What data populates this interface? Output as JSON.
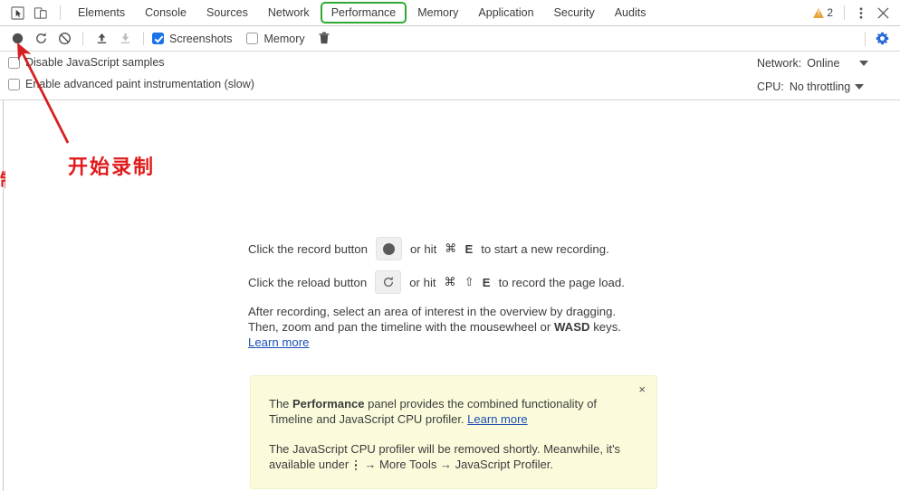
{
  "tabbar": {
    "inspect_icon": "inspect-element-icon",
    "device_icon": "device-toolbar-icon",
    "tabs": [
      {
        "label": "Elements",
        "highlighted": false
      },
      {
        "label": "Console",
        "highlighted": false
      },
      {
        "label": "Sources",
        "highlighted": false
      },
      {
        "label": "Network",
        "highlighted": false
      },
      {
        "label": "Performance",
        "highlighted": true
      },
      {
        "label": "Memory",
        "highlighted": false
      },
      {
        "label": "Application",
        "highlighted": false
      },
      {
        "label": "Security",
        "highlighted": false
      },
      {
        "label": "Audits",
        "highlighted": false
      }
    ],
    "warning_count": "2",
    "warning_icon": "warning-triangle-icon",
    "more_icon": "kebab-menu-icon",
    "close_icon": "close-icon",
    "highlight_color": "#2eaa33"
  },
  "toolbar": {
    "record_icon": "record-circle-icon",
    "reload_icon": "reload-icon",
    "clear_icon": "clear-no-entry-icon",
    "load_profile_icon": "upload-arrow-icon",
    "save_profile_icon": "download-arrow-icon",
    "screenshots_label": "Screenshots",
    "screenshots_checked": true,
    "memory_label": "Memory",
    "memory_checked": false,
    "trash_icon": "trash-icon",
    "settings_icon": "gear-icon",
    "settings_color": "#2a6ad8",
    "checkbox_color": "#1a73e8"
  },
  "settings": {
    "disable_js_label": "Disable JavaScript samples",
    "disable_js_checked": false,
    "paint_instr_label": "Enable advanced paint instrumentation (slow)",
    "paint_instr_checked": false,
    "network_label": "Network:",
    "network_value": "Online",
    "cpu_label": "CPU:",
    "cpu_value": "No throttling"
  },
  "main": {
    "record_line_prefix": "Click the record button",
    "record_line_mid": "or hit",
    "record_key_cmd": "⌘",
    "record_key_letter": "E",
    "record_line_suffix": "to start a new recording.",
    "reload_line_prefix": "Click the reload button",
    "reload_line_mid": "or hit",
    "reload_key_cmd": "⌘",
    "reload_key_shift": "⇧",
    "reload_key_letter": "E",
    "reload_line_suffix": "to record the page load.",
    "paragraph_line1": "After recording, select an area of interest in the overview by dragging.",
    "paragraph_line2_a": "Then, zoom and pan the timeline with the mousewheel or",
    "paragraph_line2_bold": "WASD",
    "paragraph_line2_b": "keys.",
    "learn_more": "Learn more",
    "link_color": "#1a4fb4"
  },
  "notice": {
    "close_label": "×",
    "p1_a": "The ",
    "p1_bold": "Performance",
    "p1_b": " panel provides the combined functionality of Timeline and JavaScript CPU profiler. ",
    "p1_link": "Learn more",
    "p2_a": "The JavaScript CPU profiler will be removed shortly. Meanwhile, it's available under ",
    "p2_b": " → More Tools → JavaScript Profiler.",
    "bg_color": "#fbfbdc"
  },
  "annotation": {
    "text": "开始录制",
    "fragment": "制",
    "color": "#e11b1b",
    "arrow_color": "#d62020"
  }
}
